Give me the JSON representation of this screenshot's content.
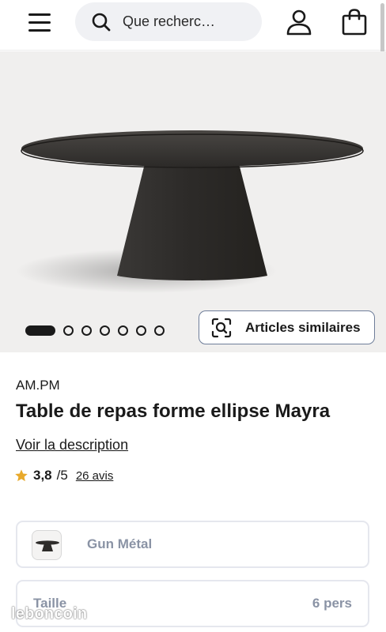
{
  "header": {
    "search_placeholder": "Que recherc…",
    "menu_icon": "hamburger-icon",
    "account_icon": "user-icon",
    "cart_icon": "shopping-bag-icon"
  },
  "gallery": {
    "total_images": 7,
    "active_index": 0,
    "similar_button_label": "Articles similaires",
    "similar_icon": "visual-search-icon"
  },
  "product": {
    "brand": "AM.PM",
    "title": "Table de repas forme ellipse Mayra",
    "description_link": "Voir la description",
    "rating": {
      "score": "3,8",
      "max": "/5",
      "reviews": "26 avis",
      "star_color": "#e8a92b"
    }
  },
  "options": {
    "color": {
      "value": "Gun Métal"
    },
    "size": {
      "label": "Taille",
      "value": "6 pers"
    }
  },
  "watermark": "leboncoin",
  "colors": {
    "text": "#1a1a1a",
    "muted": "#8a93a5",
    "border": "#e5e7ee",
    "hero_bg": "#f0efee"
  }
}
